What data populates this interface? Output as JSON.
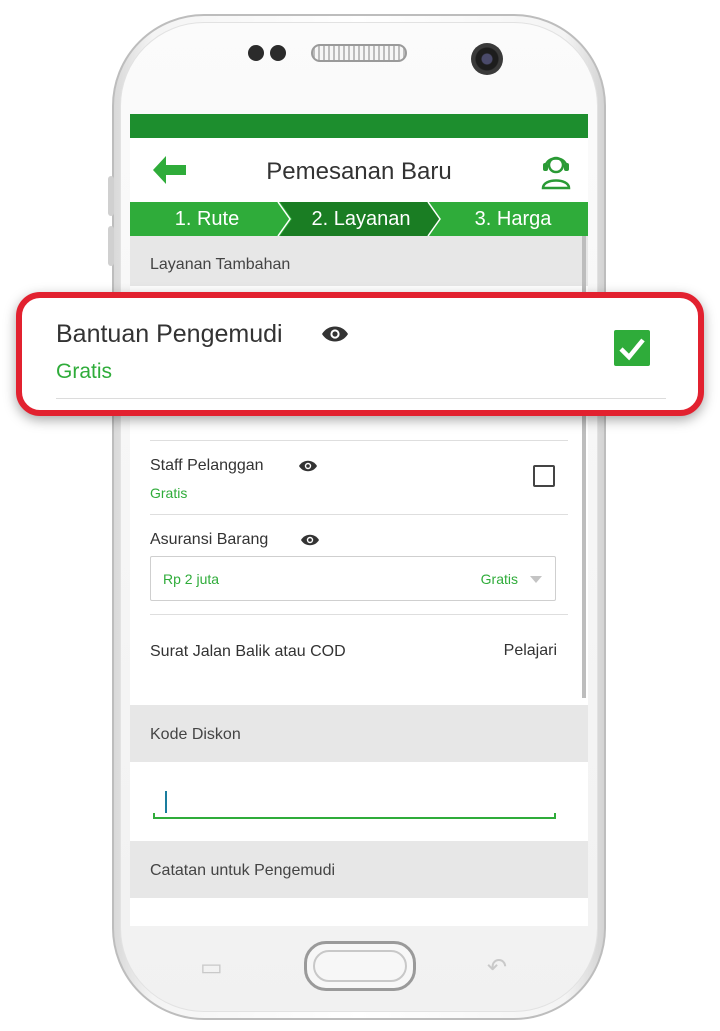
{
  "header": {
    "title": "Pemesanan Baru",
    "back_icon": "arrow-left-icon",
    "support_icon": "headset-agent-icon"
  },
  "steps": [
    {
      "label": "1. Rute",
      "active": false
    },
    {
      "label": "2. Layanan",
      "active": true
    },
    {
      "label": "3. Harga",
      "active": false
    }
  ],
  "sections": {
    "additional_services": "Layanan Tambahan",
    "discount_code": "Kode Diskon",
    "driver_notes": "Catatan untuk Pengemudi"
  },
  "services": {
    "driver_help": {
      "title": "Bantuan Pengemudi",
      "price": "Gratis",
      "checked": true
    },
    "customer_staff": {
      "title": "Staff Pelanggan",
      "price": "Gratis",
      "checked": false
    },
    "goods_insurance": {
      "title": "Asuransi Barang",
      "selected_value": "Rp 2 juta",
      "price": "Gratis"
    },
    "return_doc": {
      "title": "Surat Jalan Balik atau COD",
      "link": "Pelajari"
    }
  },
  "discount": {
    "value": ""
  },
  "colors": {
    "brand_green": "#2fac3a",
    "dark_green": "#1a7d23",
    "status_bar": "#1d8e2e",
    "highlight_red": "#e2212f"
  }
}
